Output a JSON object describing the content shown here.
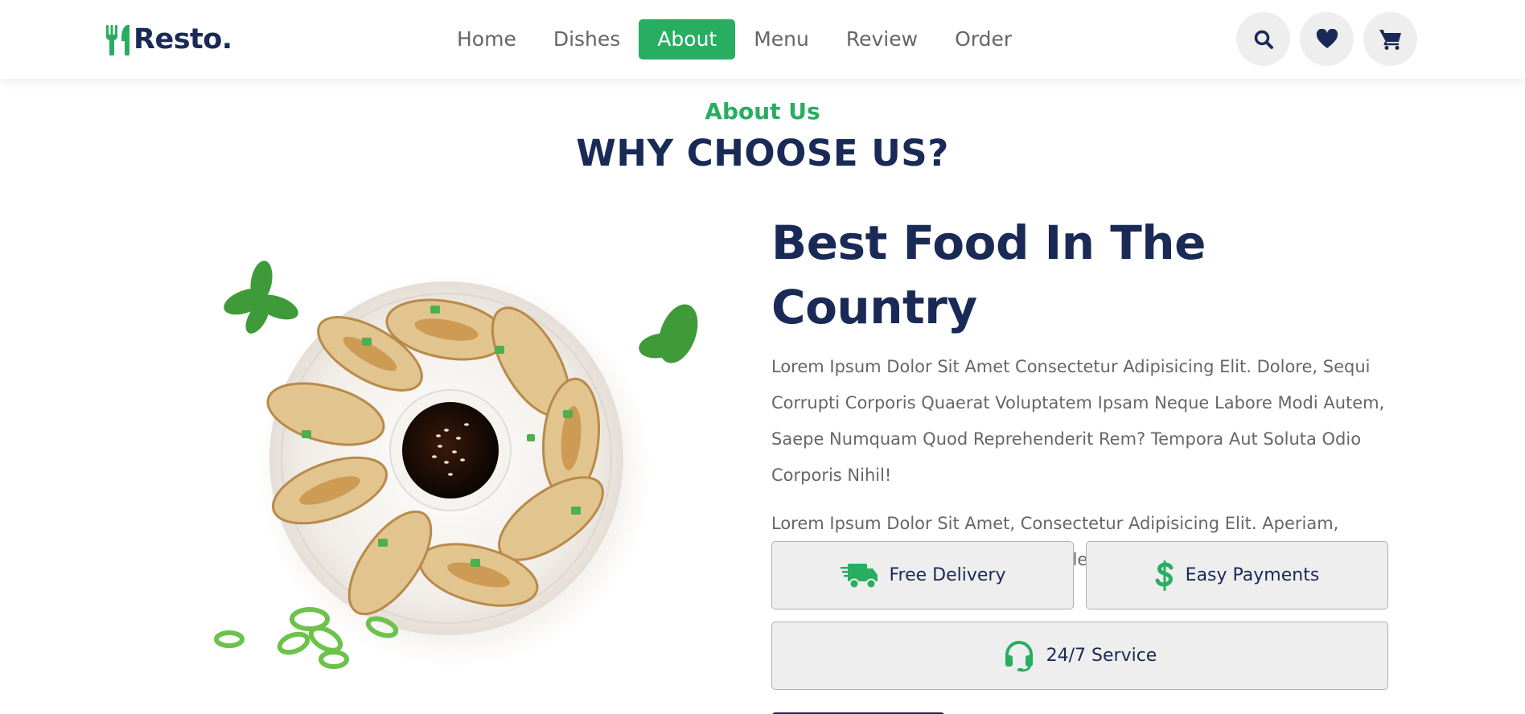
{
  "brand": {
    "name": "Resto.",
    "logo_icon": "utensils-icon",
    "accent": "#27ae60",
    "dark": "#192a56"
  },
  "nav": {
    "items": [
      {
        "label": "Home",
        "active": false
      },
      {
        "label": "Dishes",
        "active": false
      },
      {
        "label": "About",
        "active": true
      },
      {
        "label": "Menu",
        "active": false
      },
      {
        "label": "Review",
        "active": false
      },
      {
        "label": "Order",
        "active": false
      }
    ]
  },
  "header_icons": [
    "search-icon",
    "heart-icon",
    "cart-icon"
  ],
  "about": {
    "sub_heading": "About Us",
    "heading": "WHY CHOOSE US?",
    "title": "Best Food In The Country",
    "paragraph_1": "Lorem Ipsum Dolor Sit Amet Consectetur Adipisicing Elit. Dolore, Sequi Corrupti Corporis Quaerat Voluptatem Ipsam Neque Labore Modi Autem, Saepe Numquam Quod Reprehenderit Rem? Tempora Aut Soluta Odio Corporis Nihil!",
    "paragraph_2": "Lorem Ipsum Dolor Sit Amet, Consectetur Adipisicing Elit. Aperiam, Nemo. Sit Porro Illo Eos Cumque Deleniti Iste Alias, Eum Natus.",
    "features": [
      {
        "label": "Free Delivery",
        "icon": "shipping-fast-icon"
      },
      {
        "label": "Easy Payments",
        "icon": "dollar-sign-icon"
      },
      {
        "label": "24/7 Service",
        "icon": "headset-icon"
      }
    ]
  }
}
